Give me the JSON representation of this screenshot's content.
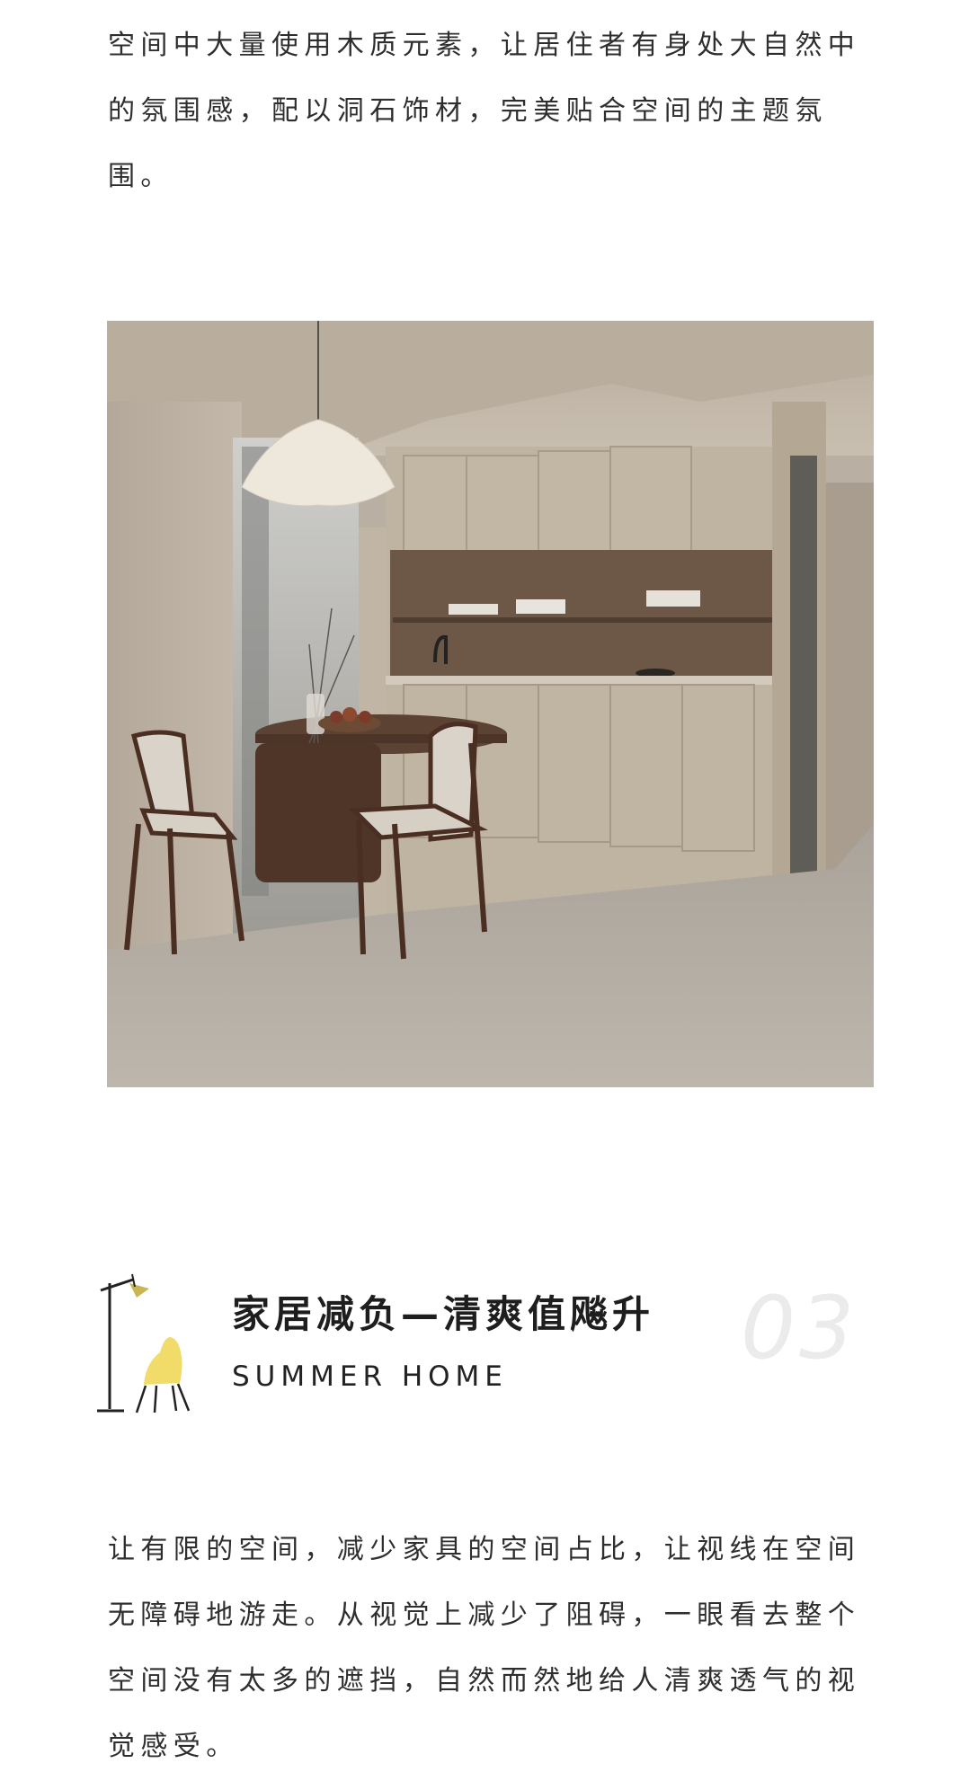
{
  "intro_paragraph": "空间中大量使用木质元素，让居住者有身处大自然中的氛围感，配以洞石饰材，完美贴合空间的主题氛围。",
  "section": {
    "title": "家居减负—清爽值飚升",
    "subtitle": "SUMMER HOME",
    "number": "03"
  },
  "body_paragraph": "让有限的空间，减少家具的空间占比，让视线在空间无障碍地游走。从视觉上减少了阻碍，一眼看去整个空间没有太多的遮挡，自然而然地给人清爽透气的视觉感受。",
  "colors": {
    "text": "#2e2e2e",
    "lamp_shade": "#c9b552",
    "chair_accent": "#f1dc6a",
    "number_watermark": "#ebebeb"
  },
  "icons": [
    "floor-lamp-icon",
    "chair-icon"
  ]
}
